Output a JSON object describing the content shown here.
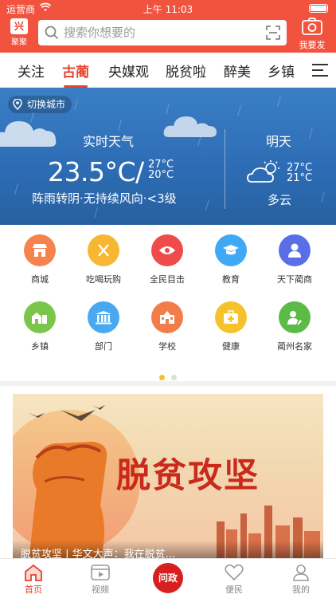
{
  "status_bar": {
    "carrier": "运营商",
    "time": "上午 11:03"
  },
  "header": {
    "logo_label": "聚聚",
    "search_placeholder": "搜索你想要的",
    "post_label": "我要发"
  },
  "tabs": [
    {
      "label": "关注"
    },
    {
      "label": "古蔺",
      "active": true
    },
    {
      "label": "央媒观"
    },
    {
      "label": "脱贫啦"
    },
    {
      "label": "醉美"
    },
    {
      "label": "乡镇"
    }
  ],
  "weather": {
    "city_switch_label": "切换城市",
    "current_title": "实时天气",
    "current_temp": "23.5°C/",
    "current_high": "27°C",
    "current_low": "20°C",
    "current_desc": "阵雨转阴·无持续风向·<3级",
    "tomorrow_title": "明天",
    "tomorrow_high": "27°C",
    "tomorrow_low": "21°C",
    "tomorrow_desc": "多云"
  },
  "grid_items": [
    {
      "label": "商城",
      "icon": "store-icon",
      "color": "#f6834d"
    },
    {
      "label": "吃喝玩购",
      "icon": "fork-knife-icon",
      "color": "#f7b733"
    },
    {
      "label": "全民目击",
      "icon": "eye-icon",
      "color": "#ef4b4b"
    },
    {
      "label": "教育",
      "icon": "graduation-cap-icon",
      "color": "#3fa9f5"
    },
    {
      "label": "天下蔺商",
      "icon": "person-icon",
      "color": "#5a6ee8"
    },
    {
      "label": "乡镇",
      "icon": "village-icon",
      "color": "#7ac64a"
    },
    {
      "label": "部门",
      "icon": "building-icon",
      "color": "#4aa8f0"
    },
    {
      "label": "学校",
      "icon": "school-icon",
      "color": "#f27c4a"
    },
    {
      "label": "健康",
      "icon": "medical-kit-icon",
      "color": "#f6c22b"
    },
    {
      "label": "蔺州名家",
      "icon": "notable-person-icon",
      "color": "#5cba47"
    }
  ],
  "pager": {
    "pages": 2,
    "current": 1
  },
  "banner": {
    "title": "脱贫攻坚",
    "caption": "脱贫攻坚 | 华文大声：我在脱贫..."
  },
  "bottom_nav": [
    {
      "label": "首页",
      "icon": "home-icon",
      "active": true
    },
    {
      "label": "视频",
      "icon": "video-icon"
    },
    {
      "label": "问政",
      "icon": "wenzheng-logo-icon"
    },
    {
      "label": "便民",
      "icon": "heart-icon"
    },
    {
      "label": "我的",
      "icon": "user-icon"
    }
  ],
  "colors": {
    "brand": "#f2533f",
    "active": "#e9402c",
    "weather_bg": "#2d6cb4"
  }
}
